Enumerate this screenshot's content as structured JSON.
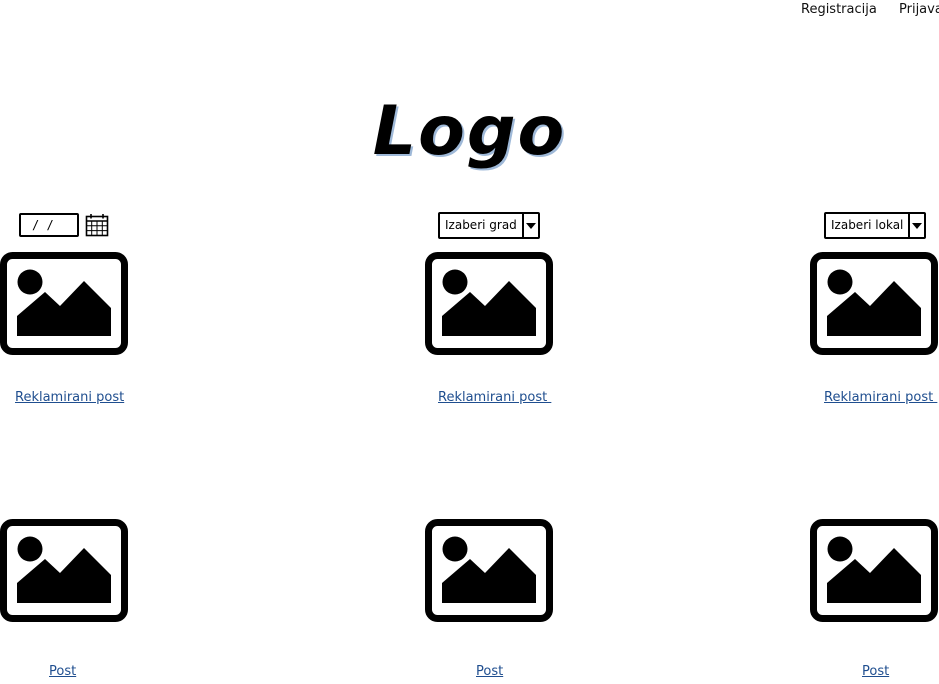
{
  "header": {
    "register_label": "Registracija",
    "login_label": "Prijava",
    "logo_text": "Logo"
  },
  "filters": {
    "date_value": "/ /",
    "city_select": {
      "selected": "Izaberi grad"
    },
    "venue_select": {
      "selected": "Izaberi lokal"
    }
  },
  "promoted_posts": [
    {
      "label": "Reklamirani post"
    },
    {
      "label": "Reklamirani post "
    },
    {
      "label": "Reklamirani post "
    }
  ],
  "posts": [
    {
      "label": "Post"
    },
    {
      "label": "Post"
    },
    {
      "label": "Post"
    }
  ],
  "icons": {
    "calendar": "calendar-icon",
    "dropdown": "chevron-down-icon",
    "image_placeholder": "image-placeholder-icon"
  }
}
